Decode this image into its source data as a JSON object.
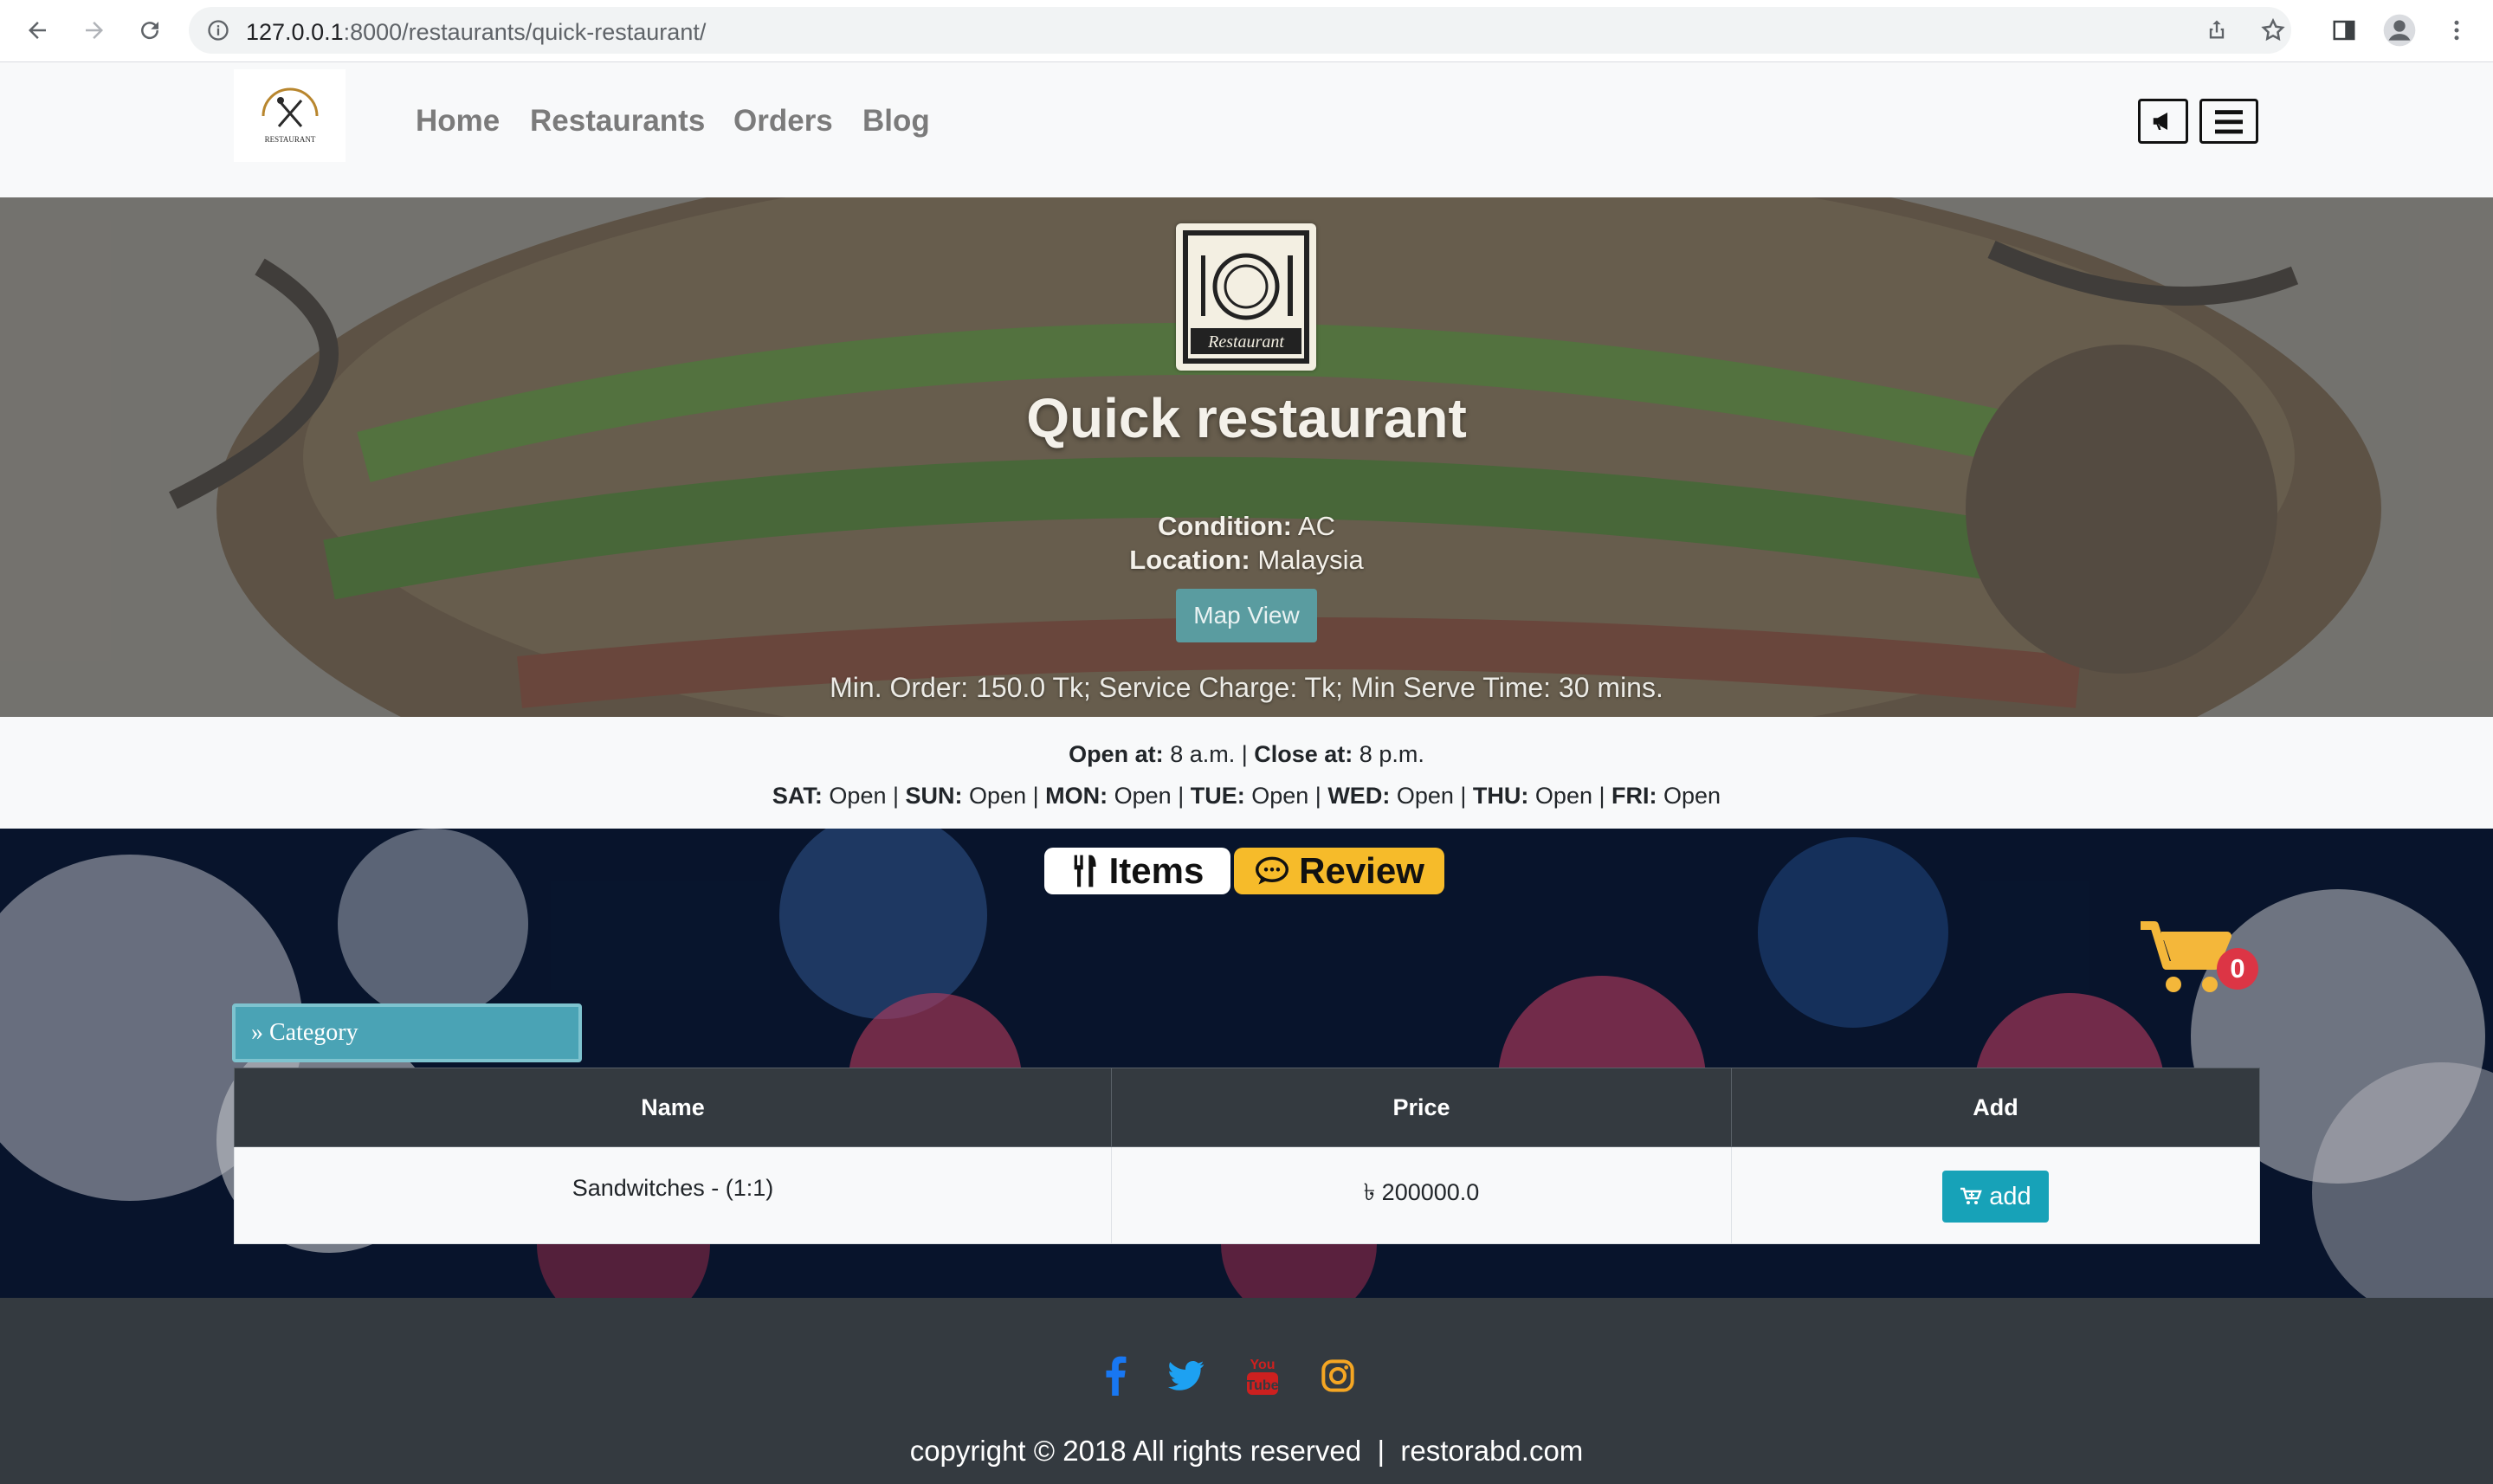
{
  "browser": {
    "url_host": "127.0.0.1",
    "url_rest": ":8000/restaurants/quick-restaurant/",
    "icons": [
      "back-arrow-icon",
      "forward-arrow-icon",
      "reload-icon",
      "info-icon",
      "share-icon",
      "star-icon",
      "side-panel-icon",
      "profile-icon",
      "kebab-menu-icon"
    ]
  },
  "navbar": {
    "logo_text": "RESTAURANT",
    "links": [
      "Home",
      "Restaurants",
      "Orders",
      "Blog"
    ],
    "icons": [
      "megaphone-icon",
      "hamburger-menu-icon"
    ]
  },
  "restaurant": {
    "logo_text": "Restaurant",
    "name": "Quick restaurant",
    "condition_label": "Condition:",
    "condition_value": "AC",
    "location_label": "Location:",
    "location_value": "Malaysia",
    "map_button": "Map View",
    "info_line": "Min. Order: 150.0 Tk; Service Charge: Tk; Min Serve Time: 30 mins."
  },
  "hours": {
    "open_label": "Open at:",
    "open_value": "8 a.m.",
    "close_label": "Close at:",
    "close_value": "8 p.m.",
    "days": [
      {
        "day": "SAT:",
        "status": "Open"
      },
      {
        "day": "SUN:",
        "status": "Open"
      },
      {
        "day": "MON:",
        "status": "Open"
      },
      {
        "day": "TUE:",
        "status": "Open"
      },
      {
        "day": "WED:",
        "status": "Open"
      },
      {
        "day": "THU:",
        "status": "Open"
      },
      {
        "day": "FRI:",
        "status": "Open"
      }
    ]
  },
  "tabs": {
    "items": "Items",
    "review": "Review"
  },
  "cart": {
    "count": "0"
  },
  "category": {
    "label": "Category"
  },
  "table": {
    "headers": [
      "Name",
      "Price",
      "Add"
    ],
    "rows": [
      {
        "name": "Sandwitches - (1:1)",
        "currency": "৳",
        "price": "200000.0",
        "add_label": "add"
      }
    ]
  },
  "footer": {
    "social": [
      "facebook-icon",
      "twitter-icon",
      "youtube-icon",
      "instagram-icon"
    ],
    "copyright": "copyright © 2018 All rights reserved",
    "separator": "|",
    "site": "restorabd.com"
  },
  "colors": {
    "primary_teal": "#17a2b8",
    "dark": "#343a40",
    "review_tab": "#f6bb2a",
    "cart_yellow": "#f4b73a",
    "badge_red": "#dc3545"
  }
}
